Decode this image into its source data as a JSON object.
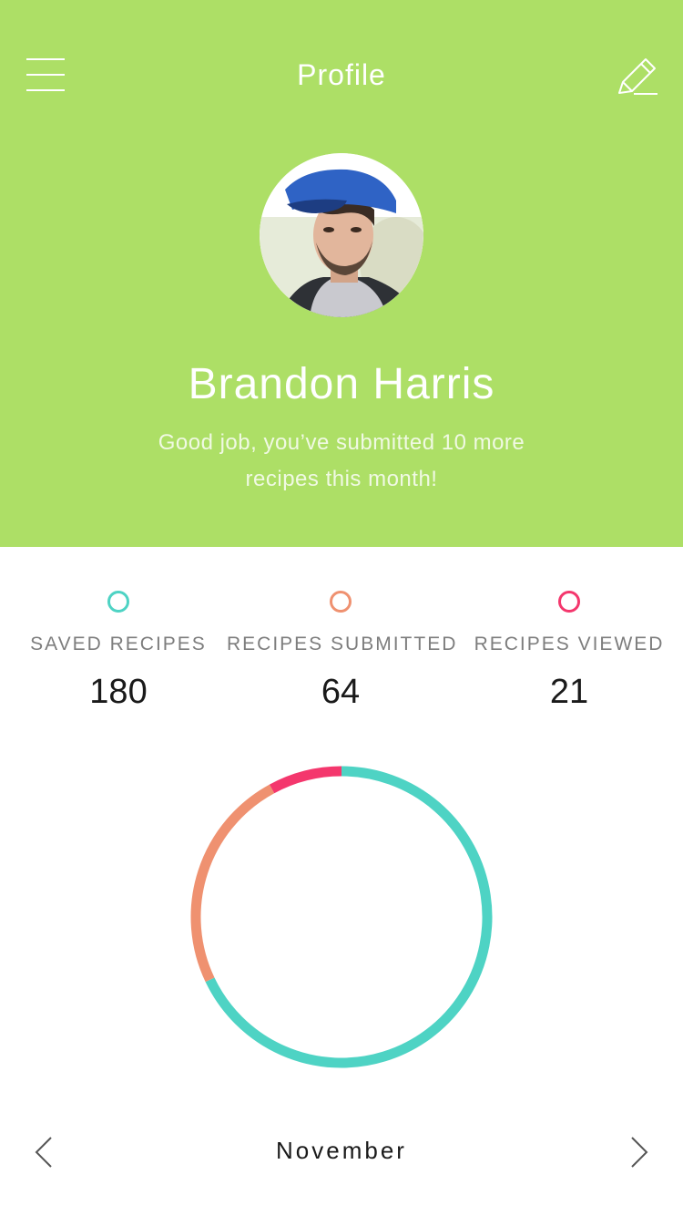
{
  "header": {
    "title": "Profile",
    "background_color": "#addf66",
    "menu_icon": "hamburger-menu-icon",
    "edit_icon": "pencil-edit-icon"
  },
  "profile": {
    "avatar_icon": "user-avatar-photo",
    "name": "Brandon Harris",
    "message": "Good job, you’ve submitted 10 more recipes this month!"
  },
  "stats": [
    {
      "label": "SAVED RECIPES",
      "value": "180",
      "color": "#4ed3c4"
    },
    {
      "label": "RECIPES SUBMITTED",
      "value": "64",
      "color": "#ef9170"
    },
    {
      "label": "RECIPES VIEWED",
      "value": "21",
      "color": "#f4376d"
    }
  ],
  "chart_data": {
    "type": "pie",
    "style": "donut-ring",
    "series": [
      {
        "name": "SAVED RECIPES",
        "value": 180,
        "color": "#4ed3c4"
      },
      {
        "name": "RECIPES SUBMITTED",
        "value": 64,
        "color": "#ef9170"
      },
      {
        "name": "RECIPES VIEWED",
        "value": 21,
        "color": "#f4376d"
      }
    ]
  },
  "footer": {
    "month": "November",
    "prev_icon": "chevron-left-icon",
    "next_icon": "chevron-right-icon"
  }
}
